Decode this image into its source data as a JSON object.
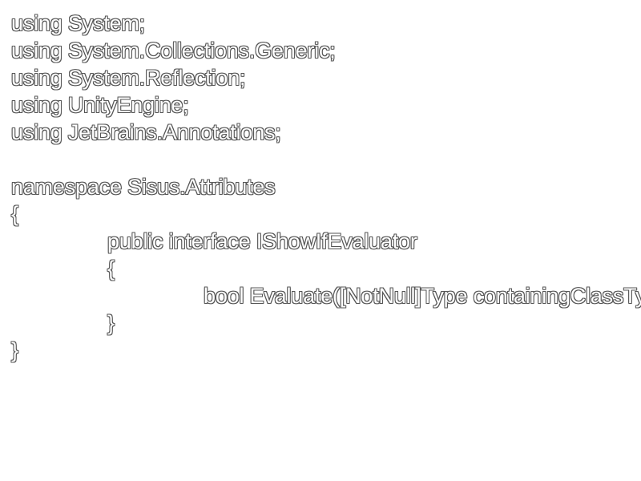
{
  "code": {
    "lines": [
      "using System;",
      "using System.Collections.Generic;",
      "using System.Reflection;",
      "using UnityEngine;",
      "using JetBrains.Annotations;",
      "",
      "namespace Sisus.Attributes",
      "{",
      "public interface IShowIfEvaluator",
      "{",
      "bool Evaluate([NotNull]Type containingClassType, [CanBeNull]object[] containingClassInstances, [NotNull]object[] parameters);",
      "}",
      "}"
    ]
  }
}
